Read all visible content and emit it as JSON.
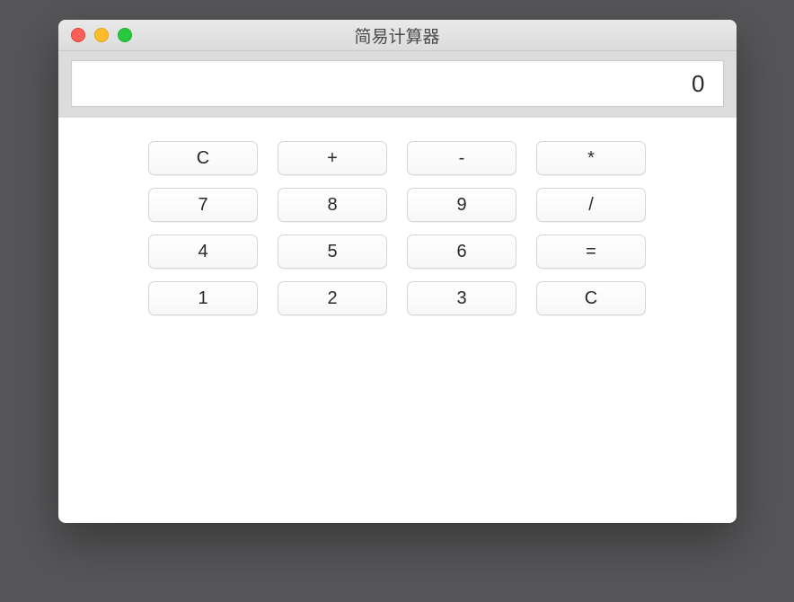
{
  "window": {
    "title": "简易计算器"
  },
  "display": {
    "value": "0"
  },
  "keypad": {
    "rows": [
      [
        "C",
        "+",
        "-",
        "*"
      ],
      [
        "7",
        "8",
        "9",
        "/"
      ],
      [
        "4",
        "5",
        "6",
        "="
      ],
      [
        "1",
        "2",
        "3",
        "C"
      ]
    ]
  }
}
